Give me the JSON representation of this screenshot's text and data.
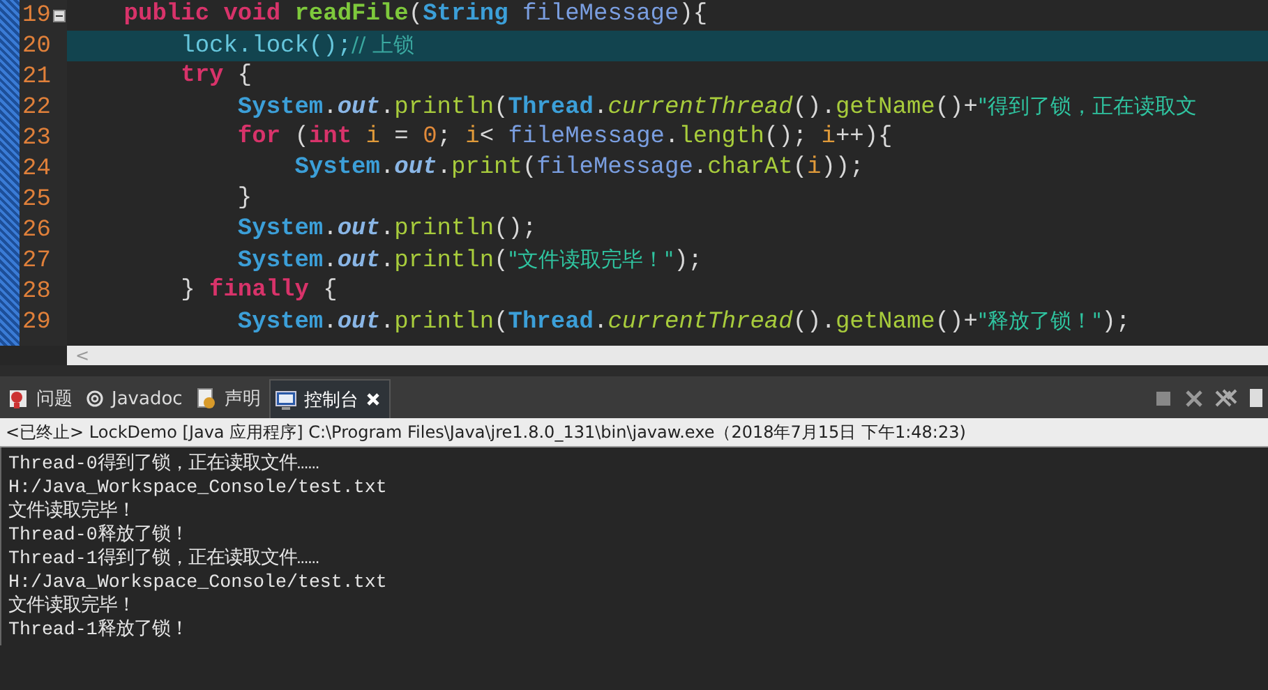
{
  "editor": {
    "lines": [
      {
        "number": "19",
        "current": false,
        "folding": true,
        "tokens": [
          {
            "kind": "kw",
            "text": "    public void "
          },
          {
            "kind": "decl",
            "text": "readFile"
          },
          {
            "kind": "plain",
            "text": "("
          },
          {
            "kind": "type",
            "text": "String "
          },
          {
            "kind": "param",
            "text": "fileMessage"
          },
          {
            "kind": "plain",
            "text": "){"
          }
        ]
      },
      {
        "number": "20",
        "current": true,
        "folding": false,
        "tokens": [
          {
            "kind": "field",
            "text": "        lock.lock();"
          },
          {
            "kind": "comment",
            "text": "// 上锁"
          }
        ]
      },
      {
        "number": "21",
        "current": false,
        "folding": false,
        "tokens": [
          {
            "kind": "kw",
            "text": "        try"
          },
          {
            "kind": "plain",
            "text": " {"
          }
        ]
      },
      {
        "number": "22",
        "current": false,
        "folding": false,
        "tokens": [
          {
            "kind": "type",
            "text": "            System"
          },
          {
            "kind": "plain",
            "text": "."
          },
          {
            "kind": "static",
            "text": "out"
          },
          {
            "kind": "plain",
            "text": "."
          },
          {
            "kind": "call",
            "text": "println"
          },
          {
            "kind": "plain",
            "text": "("
          },
          {
            "kind": "type",
            "text": "Thread"
          },
          {
            "kind": "plain",
            "text": "."
          },
          {
            "kind": "scall",
            "text": "currentThread"
          },
          {
            "kind": "plain",
            "text": "()."
          },
          {
            "kind": "call",
            "text": "getName"
          },
          {
            "kind": "plain",
            "text": "()+"
          },
          {
            "kind": "str",
            "text": "\"得到了锁，正在读取文"
          }
        ]
      },
      {
        "number": "23",
        "current": false,
        "folding": false,
        "tokens": [
          {
            "kind": "kw",
            "text": "            for"
          },
          {
            "kind": "plain",
            "text": " ("
          },
          {
            "kind": "kw",
            "text": "int "
          },
          {
            "kind": "local",
            "text": "i"
          },
          {
            "kind": "plain",
            "text": " = "
          },
          {
            "kind": "num",
            "text": "0"
          },
          {
            "kind": "plain",
            "text": "; "
          },
          {
            "kind": "local",
            "text": "i"
          },
          {
            "kind": "plain",
            "text": "< "
          },
          {
            "kind": "param",
            "text": "fileMessage"
          },
          {
            "kind": "plain",
            "text": "."
          },
          {
            "kind": "call",
            "text": "length"
          },
          {
            "kind": "plain",
            "text": "(); "
          },
          {
            "kind": "local",
            "text": "i"
          },
          {
            "kind": "plain",
            "text": "++){"
          }
        ]
      },
      {
        "number": "24",
        "current": false,
        "folding": false,
        "tokens": [
          {
            "kind": "type",
            "text": "                System"
          },
          {
            "kind": "plain",
            "text": "."
          },
          {
            "kind": "static",
            "text": "out"
          },
          {
            "kind": "plain",
            "text": "."
          },
          {
            "kind": "call",
            "text": "print"
          },
          {
            "kind": "plain",
            "text": "("
          },
          {
            "kind": "param",
            "text": "fileMessage"
          },
          {
            "kind": "plain",
            "text": "."
          },
          {
            "kind": "call",
            "text": "charAt"
          },
          {
            "kind": "plain",
            "text": "("
          },
          {
            "kind": "local",
            "text": "i"
          },
          {
            "kind": "plain",
            "text": "));"
          }
        ]
      },
      {
        "number": "25",
        "current": false,
        "folding": false,
        "tokens": [
          {
            "kind": "plain",
            "text": "            }"
          }
        ]
      },
      {
        "number": "26",
        "current": false,
        "folding": false,
        "tokens": [
          {
            "kind": "type",
            "text": "            System"
          },
          {
            "kind": "plain",
            "text": "."
          },
          {
            "kind": "static",
            "text": "out"
          },
          {
            "kind": "plain",
            "text": "."
          },
          {
            "kind": "call",
            "text": "println"
          },
          {
            "kind": "plain",
            "text": "();"
          }
        ]
      },
      {
        "number": "27",
        "current": false,
        "folding": false,
        "tokens": [
          {
            "kind": "type",
            "text": "            System"
          },
          {
            "kind": "plain",
            "text": "."
          },
          {
            "kind": "static",
            "text": "out"
          },
          {
            "kind": "plain",
            "text": "."
          },
          {
            "kind": "call",
            "text": "println"
          },
          {
            "kind": "plain",
            "text": "("
          },
          {
            "kind": "str",
            "text": "\"文件读取完毕！\""
          },
          {
            "kind": "plain",
            "text": ");"
          }
        ]
      },
      {
        "number": "28",
        "current": false,
        "folding": false,
        "tokens": [
          {
            "kind": "plain",
            "text": "        } "
          },
          {
            "kind": "kw",
            "text": "finally"
          },
          {
            "kind": "plain",
            "text": " {"
          }
        ]
      },
      {
        "number": "29",
        "current": false,
        "folding": false,
        "tokens": [
          {
            "kind": "type",
            "text": "            System"
          },
          {
            "kind": "plain",
            "text": "."
          },
          {
            "kind": "static",
            "text": "out"
          },
          {
            "kind": "plain",
            "text": "."
          },
          {
            "kind": "call",
            "text": "println"
          },
          {
            "kind": "plain",
            "text": "("
          },
          {
            "kind": "type",
            "text": "Thread"
          },
          {
            "kind": "plain",
            "text": "."
          },
          {
            "kind": "scall",
            "text": "currentThread"
          },
          {
            "kind": "plain",
            "text": "()."
          },
          {
            "kind": "call",
            "text": "getName"
          },
          {
            "kind": "plain",
            "text": "()+"
          },
          {
            "kind": "str",
            "text": "\"释放了锁！\""
          },
          {
            "kind": "plain",
            "text": ");"
          }
        ]
      }
    ],
    "scroll_left": "<"
  },
  "tabs": [
    {
      "label": "问题",
      "kind": "problems",
      "selected": false,
      "closable": false
    },
    {
      "label": "Javadoc",
      "kind": "javadoc",
      "selected": false,
      "closable": false
    },
    {
      "label": "声明",
      "kind": "declaration",
      "selected": false,
      "closable": false
    },
    {
      "label": "控制台",
      "kind": "console",
      "selected": true,
      "closable": true
    }
  ],
  "console": {
    "header": "<已终止> LockDemo [Java 应用程序] C:\\Program Files\\Java\\jre1.8.0_131\\bin\\javaw.exe（2018年7月15日 下午1:48:23)",
    "lines": [
      "Thread-0得到了锁，正在读取文件……",
      "H:/Java_Workspace_Console/test.txt",
      "文件读取完毕！",
      "Thread-0释放了锁！",
      "Thread-1得到了锁，正在读取文件……",
      "H:/Java_Workspace_Console/test.txt",
      "文件读取完毕！",
      "Thread-1释放了锁！"
    ]
  }
}
